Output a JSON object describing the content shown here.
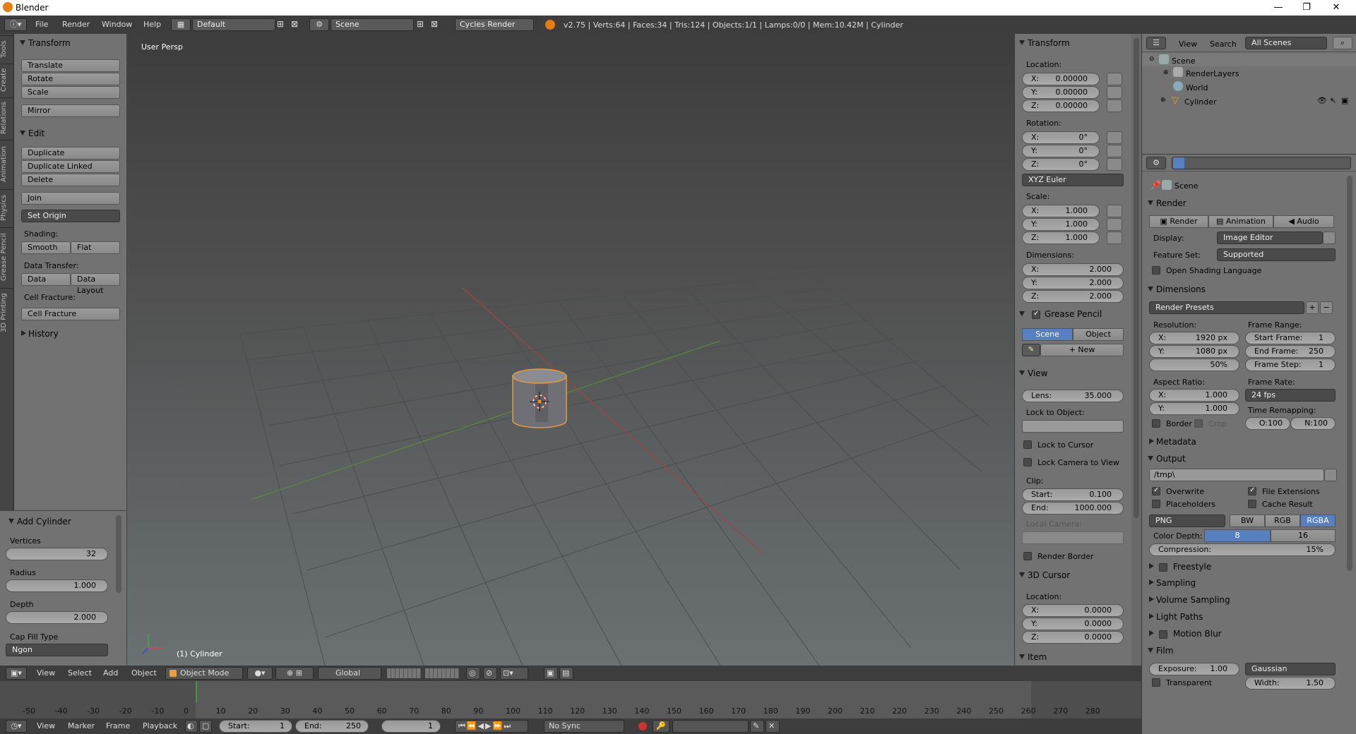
{
  "window": {
    "title": "Blender",
    "minimize": "—",
    "maximize": "❐",
    "close": "✕"
  },
  "topbar": {
    "menus": [
      "File",
      "Render",
      "Window",
      "Help"
    ],
    "layout": "Default",
    "scene": "Scene",
    "engine": "Cycles Render",
    "stats": "v2.75 | Verts:64 | Faces:34 | Tris:124 | Objects:1/1 | Lamps:0/0 | Mem:10.42M | Cylinder"
  },
  "left_tabs": [
    "Tools",
    "Create",
    "Relations",
    "Animation",
    "Physics",
    "Grease Pencil",
    "3D Printing"
  ],
  "tools": {
    "transform_title": "Transform",
    "translate": "Translate",
    "rotate": "Rotate",
    "scale": "Scale",
    "mirror": "Mirror",
    "edit_title": "Edit",
    "duplicate": "Duplicate",
    "duplicate_linked": "Duplicate Linked",
    "delete": "Delete",
    "join": "Join",
    "set_origin": "Set Origin",
    "shading_label": "Shading:",
    "smooth": "Smooth",
    "flat": "Flat",
    "data_transfer_label": "Data Transfer:",
    "data": "Data",
    "data_layout": "Data Layout",
    "cell_fracture_label": "Cell Fracture:",
    "cell_fracture": "Cell Fracture",
    "history_title": "History"
  },
  "operator": {
    "title": "Add Cylinder",
    "vertices_label": "Vertices",
    "vertices": "32",
    "radius_label": "Radius",
    "radius": "1.000",
    "depth_label": "Depth",
    "depth": "2.000",
    "cap_label": "Cap Fill Type",
    "cap": "Ngon"
  },
  "viewport": {
    "label": "User Persp",
    "object_label": "(1) Cylinder"
  },
  "npanel": {
    "transform_title": "Transform",
    "location_label": "Location:",
    "loc": {
      "x": "0.00000",
      "y": "0.00000",
      "z": "0.00000"
    },
    "rotation_label": "Rotation:",
    "rot": {
      "x": "0°",
      "y": "0°",
      "z": "0°"
    },
    "rotation_mode": "XYZ Euler",
    "scale_label": "Scale:",
    "scale": {
      "x": "1.000",
      "y": "1.000",
      "z": "1.000"
    },
    "dimensions_label": "Dimensions:",
    "dim": {
      "x": "2.000",
      "y": "2.000",
      "z": "2.000"
    },
    "grease_title": "Grease Pencil",
    "gp_scene": "Scene",
    "gp_object": "Object",
    "gp_new": "New",
    "view_title": "View",
    "lens_label": "Lens:",
    "lens": "35.000",
    "lock_object_label": "Lock to Object:",
    "lock_cursor": "Lock to Cursor",
    "lock_camera": "Lock Camera to View",
    "clip_label": "Clip:",
    "clip_start_label": "Start:",
    "clip_start": "0.100",
    "clip_end_label": "End:",
    "clip_end": "1000.000",
    "local_camera_label": "Local Camera:",
    "render_border": "Render Border",
    "cursor_title": "3D Cursor",
    "cursor_location_label": "Location:",
    "cursor": {
      "x": "0.0000",
      "y": "0.0000",
      "z": "0.0000"
    },
    "item_title": "Item",
    "x": "X:",
    "y": "Y:",
    "z": "Z:"
  },
  "outliner": {
    "view": "View",
    "search": "Search",
    "filter": "All Scenes",
    "items": [
      "Scene",
      "RenderLayers",
      "World",
      "Cylinder"
    ]
  },
  "properties": {
    "context": "Scene",
    "render_title": "Render",
    "render_btn": "Render",
    "animation_btn": "Animation",
    "audio_btn": "Audio",
    "display_label": "Display:",
    "display": "Image Editor",
    "feature_label": "Feature Set:",
    "feature": "Supported",
    "osl": "Open Shading Language",
    "dimensions_title": "Dimensions",
    "presets": "Render Presets",
    "resolution_label": "Resolution:",
    "res_x": "1920 px",
    "res_y": "1080 px",
    "res_pct": "50%",
    "frame_range_label": "Frame Range:",
    "start_frame_label": "Start Frame:",
    "start_frame": "1",
    "end_frame_label": "End Frame:",
    "end_frame": "250",
    "frame_step_label": "Frame Step:",
    "frame_step": "1",
    "aspect_label": "Aspect Ratio:",
    "aspect_x": "1.000",
    "aspect_y": "1.000",
    "frame_rate_label": "Frame Rate:",
    "frame_rate": "24 fps",
    "time_remap_label": "Time Remapping:",
    "remap_old": "O:100",
    "remap_new": "N:100",
    "border": "Border",
    "crop": "Crop",
    "metadata_title": "Metadata",
    "output_title": "Output",
    "output_path": "/tmp\\",
    "overwrite": "Overwrite",
    "file_ext": "File Extensions",
    "placeholders": "Placeholders",
    "cache_result": "Cache Result",
    "format": "PNG",
    "bw": "BW",
    "rgb": "RGB",
    "rgba": "RGBA",
    "color_depth_label": "Color Depth:",
    "depth8": "8",
    "depth16": "16",
    "compression_label": "Compression:",
    "compression": "15%",
    "freestyle_title": "Freestyle",
    "sampling_title": "Sampling",
    "volume_title": "Volume Sampling",
    "light_paths_title": "Light Paths",
    "motion_blur_title": "Motion Blur",
    "film_title": "Film",
    "exposure_label": "Exposure:",
    "exposure": "1.00",
    "filter": "Gaussian",
    "transparent": "Transparent",
    "width_label": "Width:",
    "width": "1.50"
  },
  "bottombar": {
    "view": "View",
    "select": "Select",
    "add": "Add",
    "object": "Object",
    "mode": "Object Mode",
    "orientation": "Global"
  },
  "timeline": {
    "ticks": [
      "-50",
      "-40",
      "-30",
      "-20",
      "-10",
      "0",
      "10",
      "20",
      "30",
      "40",
      "50",
      "60",
      "70",
      "80",
      "90",
      "100",
      "110",
      "120",
      "130",
      "140",
      "150",
      "160",
      "170",
      "180",
      "190",
      "200",
      "210",
      "220",
      "230",
      "240",
      "250",
      "260",
      "270",
      "280"
    ]
  },
  "timebar": {
    "view": "View",
    "marker": "Marker",
    "frame": "Frame",
    "playback": "Playback",
    "start_label": "Start:",
    "start": "1",
    "end_label": "End:",
    "end": "250",
    "current": "1",
    "sync": "No Sync"
  }
}
